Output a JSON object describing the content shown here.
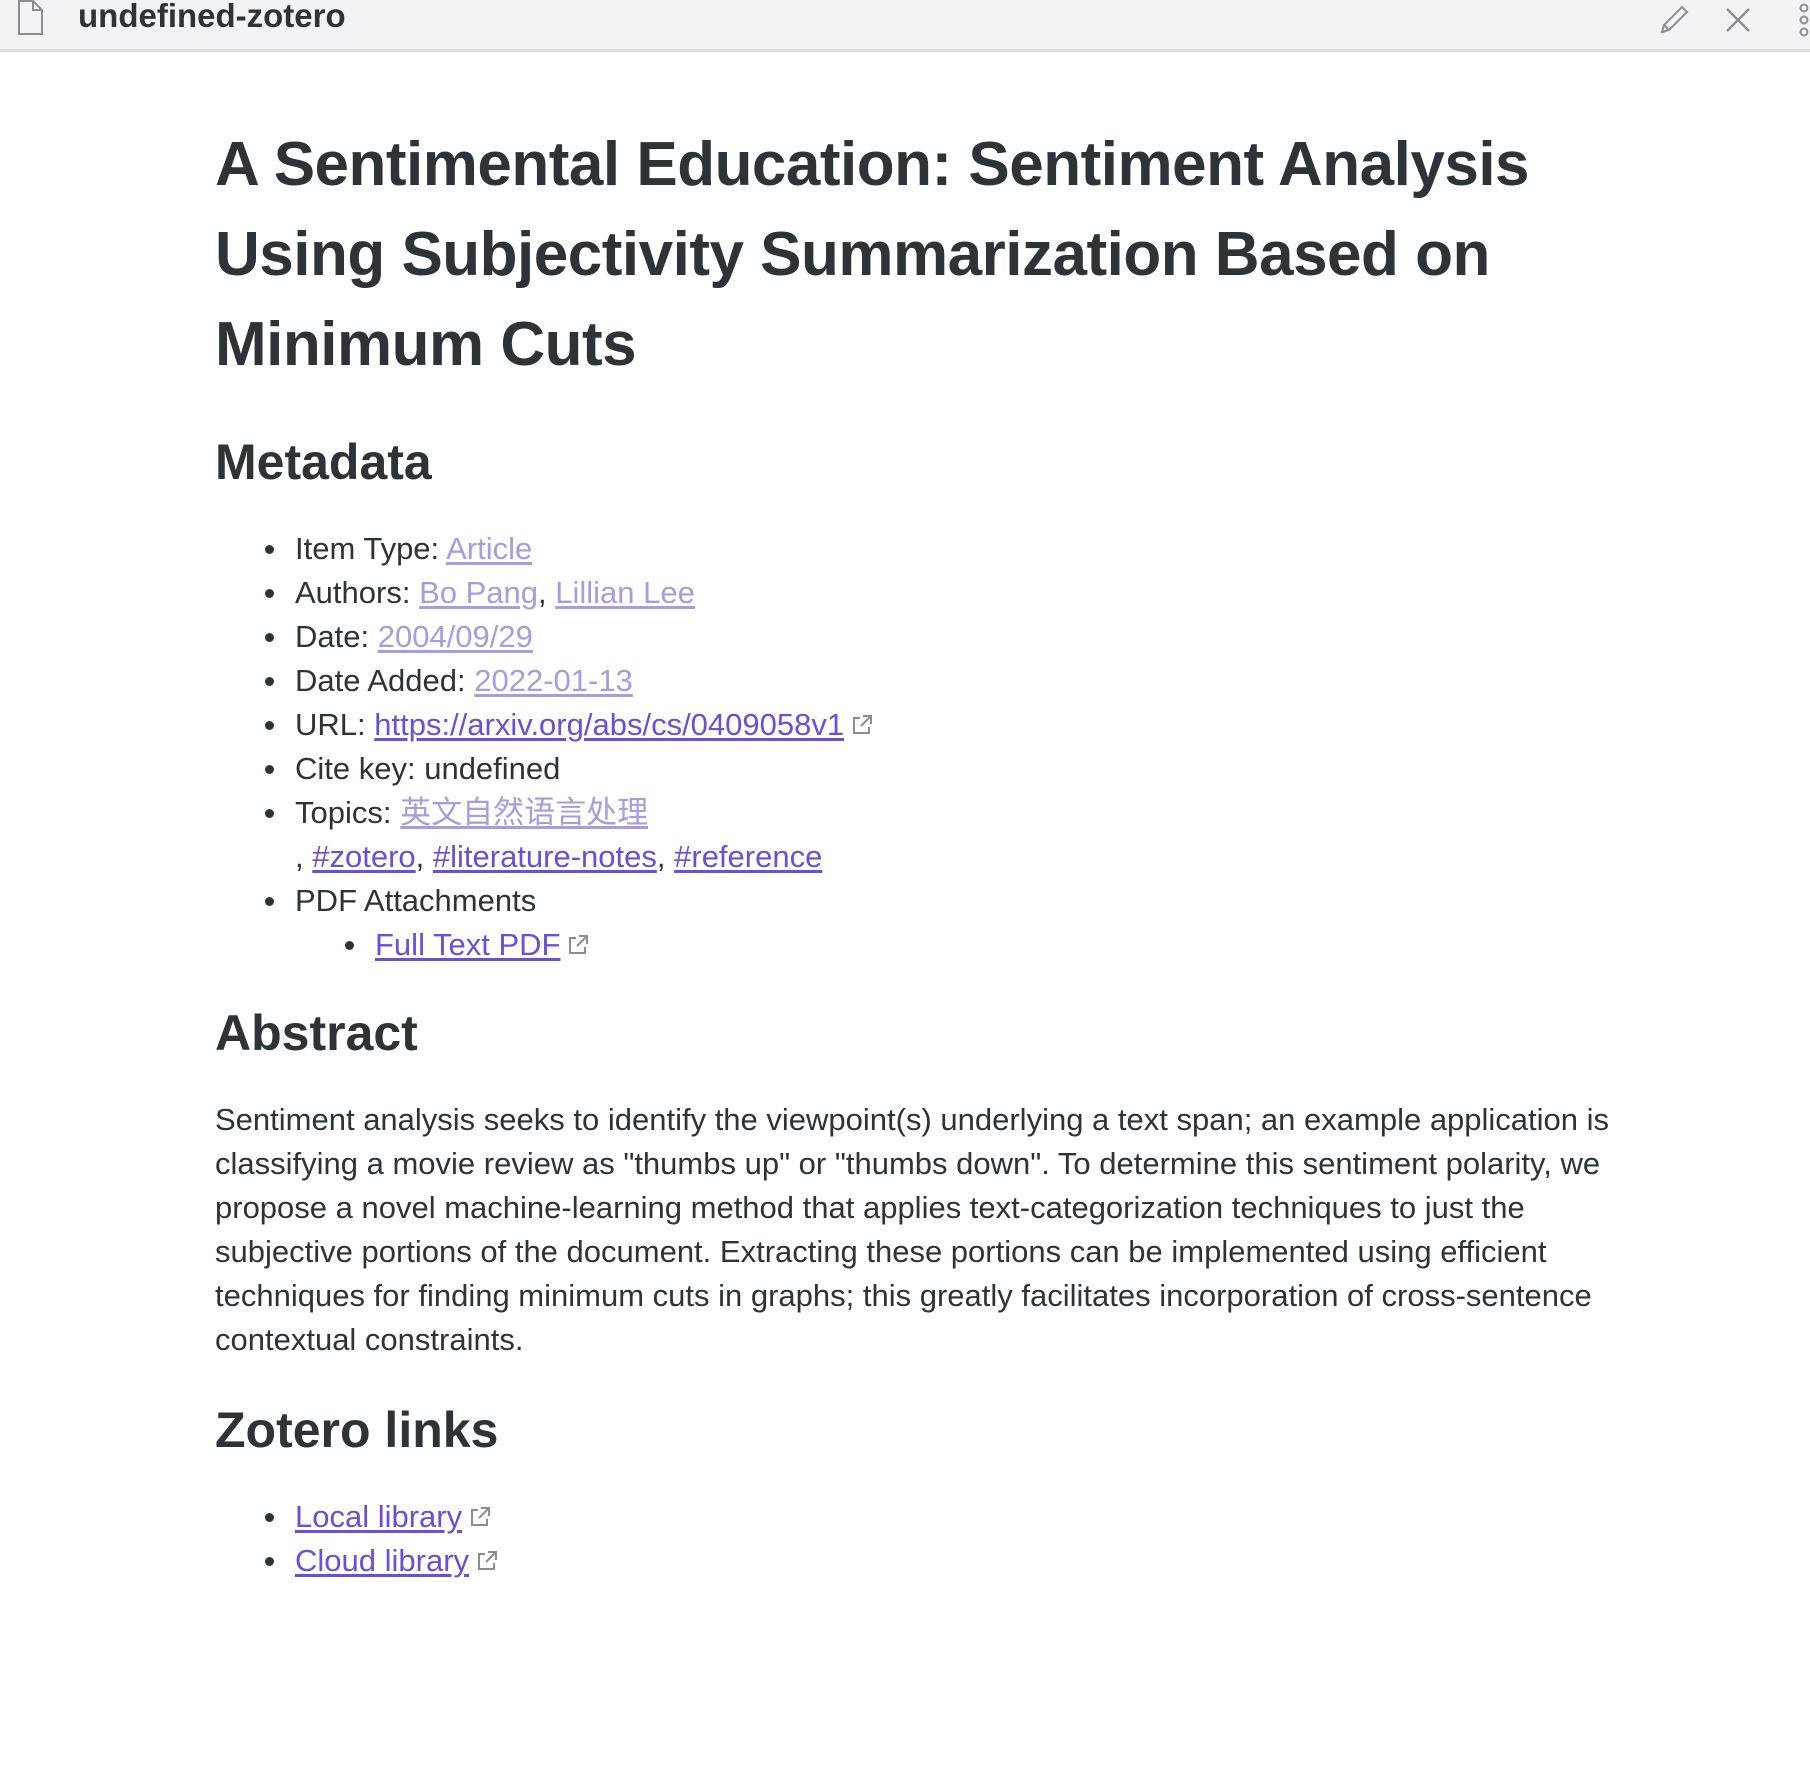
{
  "tab": {
    "title": "undefined-zotero",
    "icons": {
      "file": "file-icon",
      "edit": "pencil-icon",
      "close": "close-icon",
      "more": "more-vertical-icon"
    }
  },
  "document": {
    "title": "A Sentimental Education: Sentiment Analysis Using Subjectivity Summarization Based on Minimum Cuts",
    "metadata": {
      "heading": "Metadata",
      "item_type_label": "Item Type: ",
      "item_type": "Article",
      "authors_label": "Authors: ",
      "author1": "Bo Pang",
      "author_sep": ", ",
      "author2": "Lillian Lee",
      "date_label": "Date: ",
      "date": "2004/09/29",
      "date_added_label": "Date Added: ",
      "date_added": "2022-01-13",
      "url_label": "URL: ",
      "url": "https://arxiv.org/abs/cs/0409058v1",
      "cite_key": "Cite key: undefined",
      "topics_label": "Topics: ",
      "topic": "英文自然语言处理",
      "tags_prefix": ", ",
      "tag1": "#zotero",
      "tag_sep1": ", ",
      "tag2": "#literature-notes",
      "tag_sep2": ", ",
      "tag3": "#reference",
      "pdf_attachments_label": "PDF Attachments",
      "full_text_pdf": "Full Text PDF"
    },
    "abstract": {
      "heading": "Abstract",
      "text": "Sentiment analysis seeks to identify the viewpoint(s) underlying a text span; an example application is classifying a movie review as \"thumbs up\" or \"thumbs down\". To determine this sentiment polarity, we propose a novel machine-learning method that applies text-categorization techniques to just the subjective portions of the document. Extracting these portions can be implemented using efficient techniques for finding minimum cuts in graphs; this greatly facilitates incorporation of cross-sentence contextual constraints."
    },
    "zotero_links": {
      "heading": "Zotero links",
      "local": "Local library",
      "cloud": "Cloud library"
    }
  },
  "colors": {
    "text": "#2e3338",
    "link": "#6b4fd6",
    "link_faint": "#a99be0",
    "titlebar_bg": "#f2f3f5"
  }
}
